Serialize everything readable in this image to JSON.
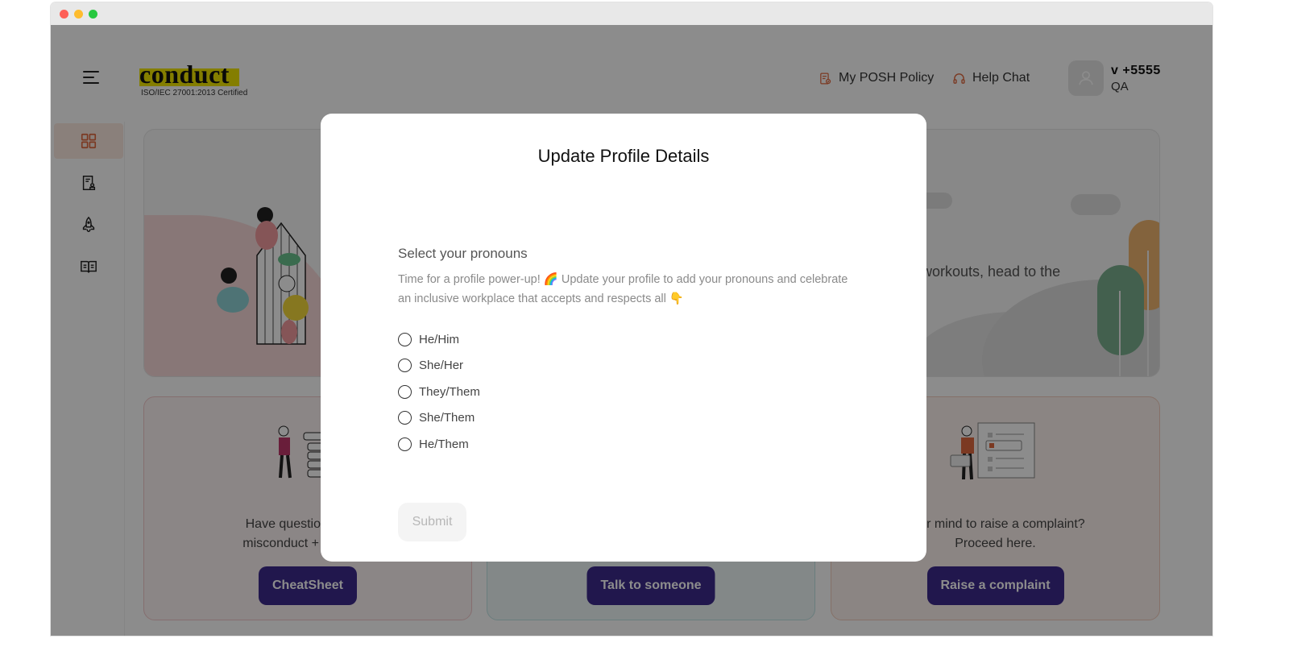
{
  "header": {
    "logo_text": "conduct",
    "logo_subtitle": "ISO/IEC 27001:2013 Certified",
    "links": [
      {
        "label": "My POSH Policy",
        "icon": "policy-document-icon"
      },
      {
        "label": "Help Chat",
        "icon": "headset-icon"
      }
    ],
    "user": {
      "name": "v +5555",
      "role": "QA",
      "icon": "user-icon"
    }
  },
  "sidebar": {
    "items": [
      {
        "icon": "dashboard-grid-icon",
        "active": true
      },
      {
        "icon": "certificate-document-icon",
        "active": false
      },
      {
        "icon": "rocket-icon",
        "active": false
      },
      {
        "icon": "open-book-icon",
        "active": false
      }
    ]
  },
  "hero": {
    "text": "workouts, head to the"
  },
  "cards": [
    {
      "text": "Have questions about sexual misconduct + your rights?",
      "visible_text_line1": "Have questions about",
      "visible_text_line2": "misconduct + your righ",
      "button": "CheatSheet"
    },
    {
      "text": "",
      "button": "Talk to someone"
    },
    {
      "text_line1": "your mind to raise a complaint?",
      "text_line2": "Proceed here.",
      "button": "Raise a complaint"
    }
  ],
  "modal": {
    "title": "Update Profile Details",
    "heading": "Select your pronouns",
    "description": "Time for a profile power-up! 🌈 Update your profile to add your pronouns and celebrate an inclusive workplace that accepts and respects all 👇",
    "options": [
      "He/Him",
      "She/Her",
      "They/Them",
      "She/Them",
      "He/Them"
    ],
    "selected": null,
    "submit_label": "Submit",
    "submit_disabled": true
  },
  "colors": {
    "accent": "#e0683f",
    "primary_button": "#3d2a8c",
    "logo_highlight": "#f0e500"
  }
}
